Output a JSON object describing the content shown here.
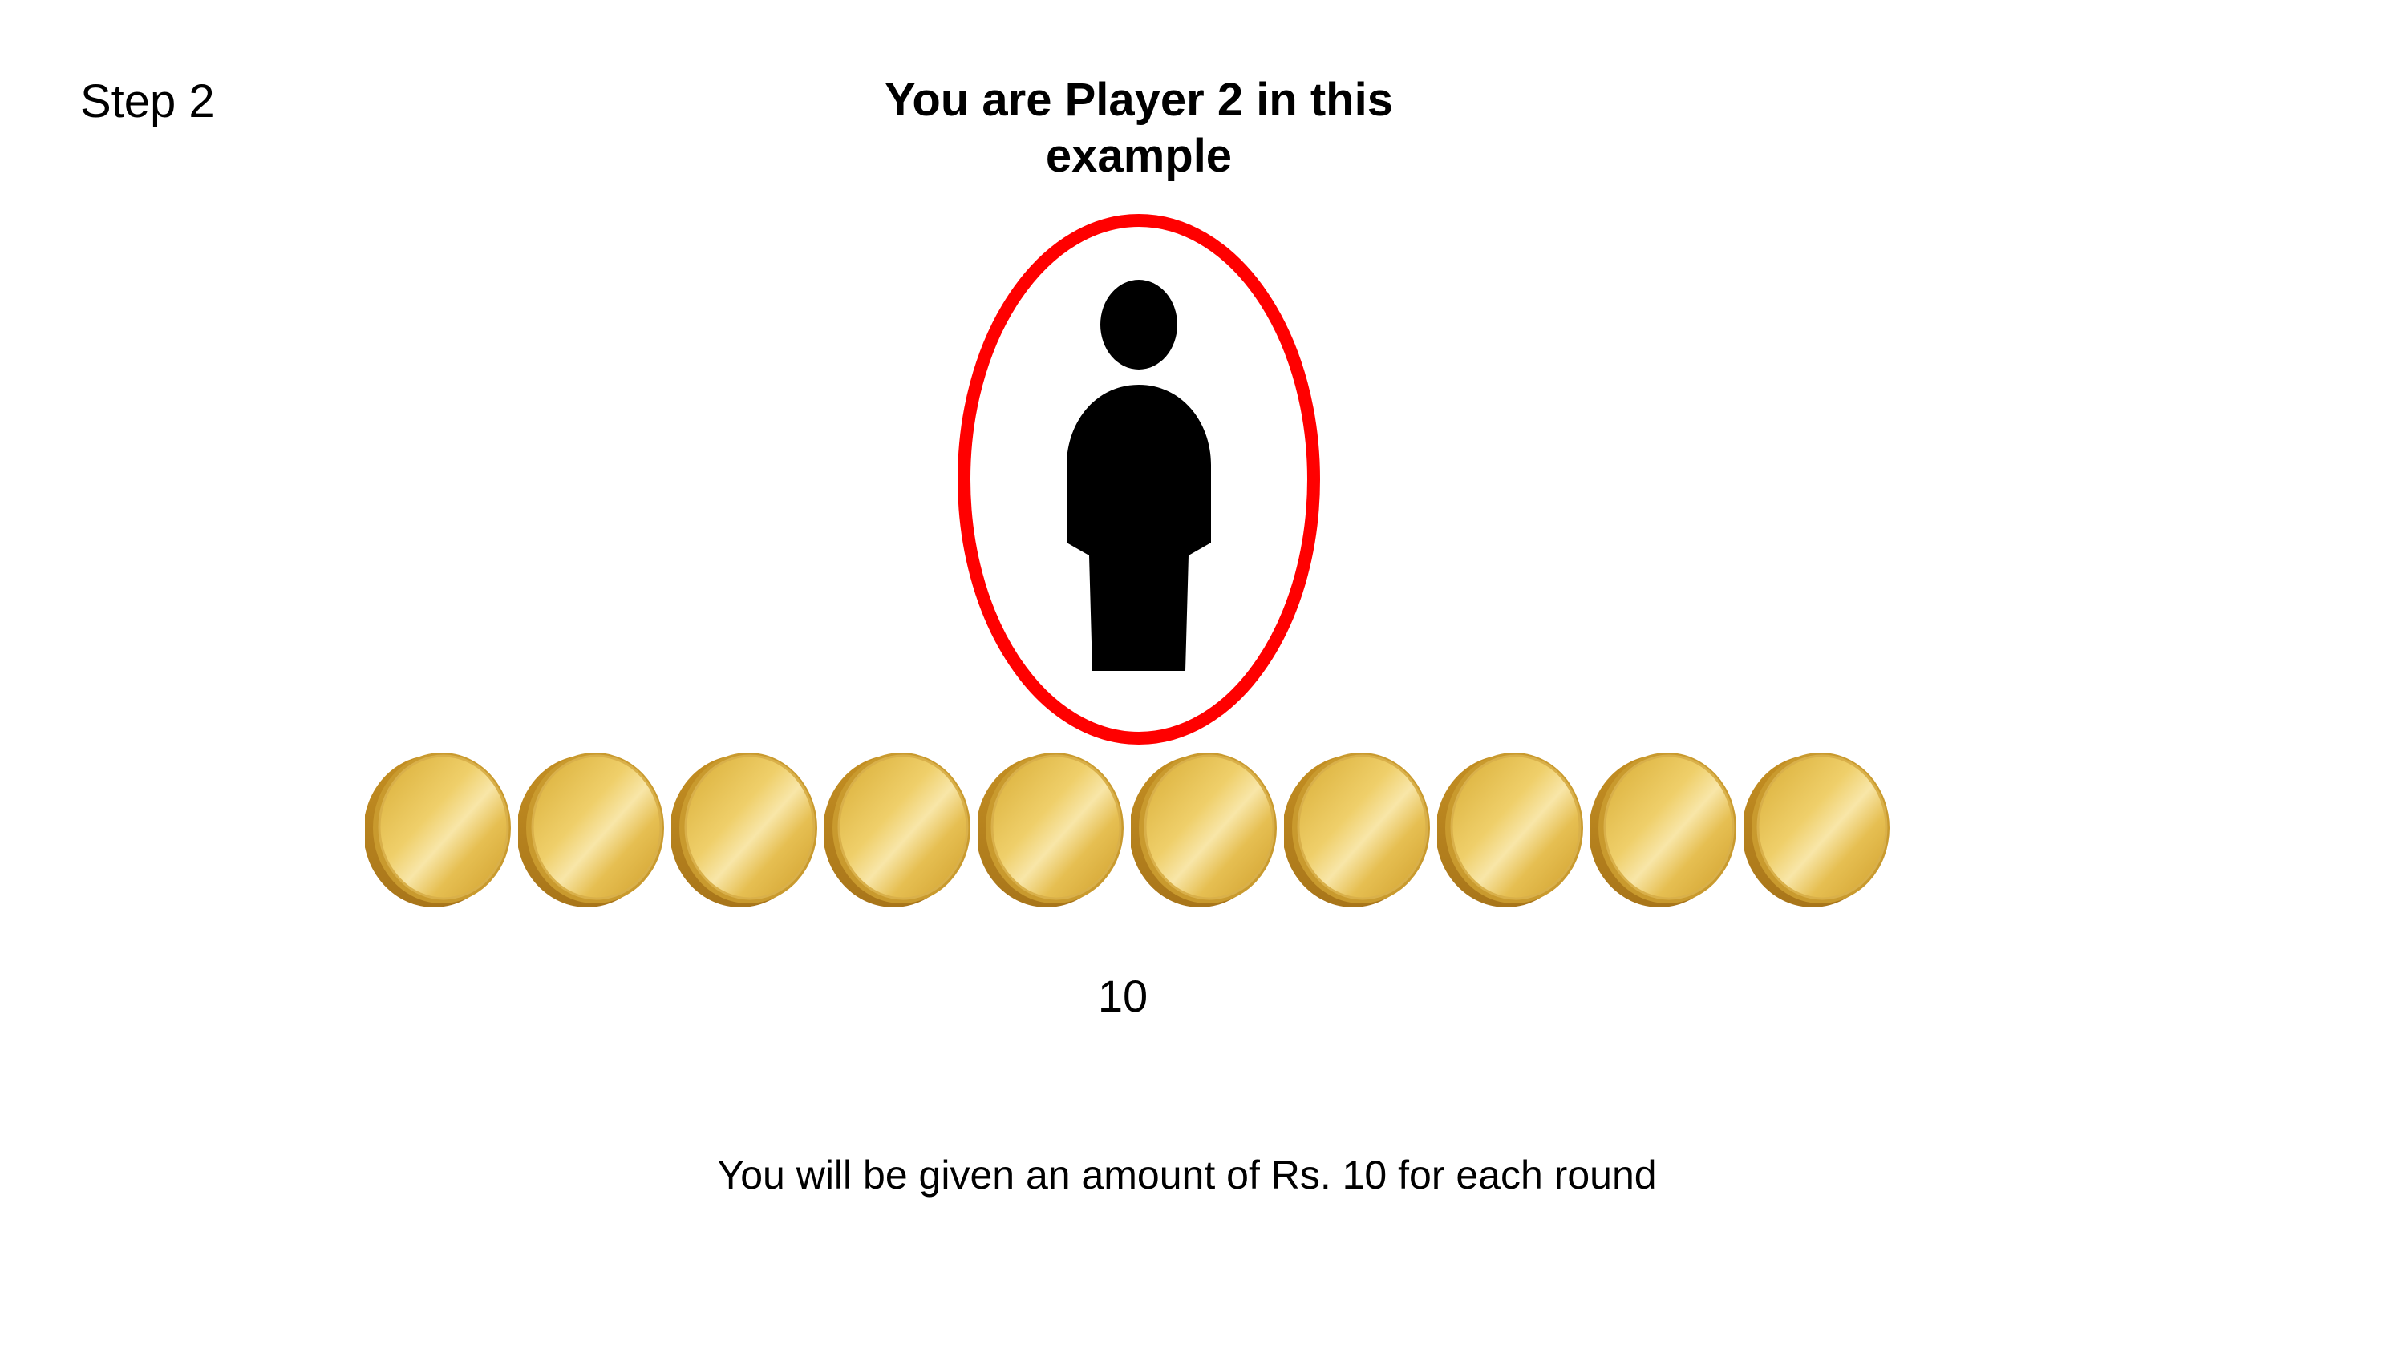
{
  "step_label": "Step 2",
  "title": "You are Player 2 in this example",
  "player": {
    "icon": "person-icon",
    "highlight_color": "#ff0000"
  },
  "coins": {
    "count": 10,
    "icon": "gold-coin-icon",
    "color": "#e8c14a"
  },
  "amount": "10",
  "footer_note": "You will be given an amount of Rs. 10 for each round"
}
